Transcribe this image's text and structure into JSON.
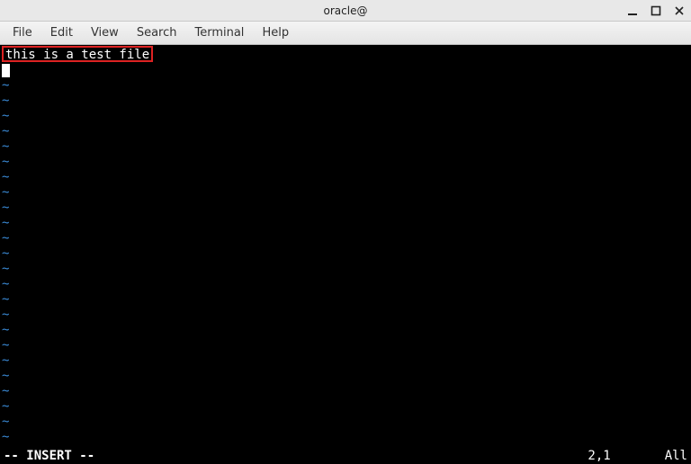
{
  "window": {
    "title": "oracle@"
  },
  "menubar": {
    "items": [
      "File",
      "Edit",
      "View",
      "Search",
      "Terminal",
      "Help"
    ]
  },
  "editor": {
    "line1_text": "this is a test file",
    "tilde_char": "~",
    "tilde_count": 25
  },
  "status": {
    "mode": "-- INSERT --",
    "position": "2,1",
    "view": "All"
  }
}
